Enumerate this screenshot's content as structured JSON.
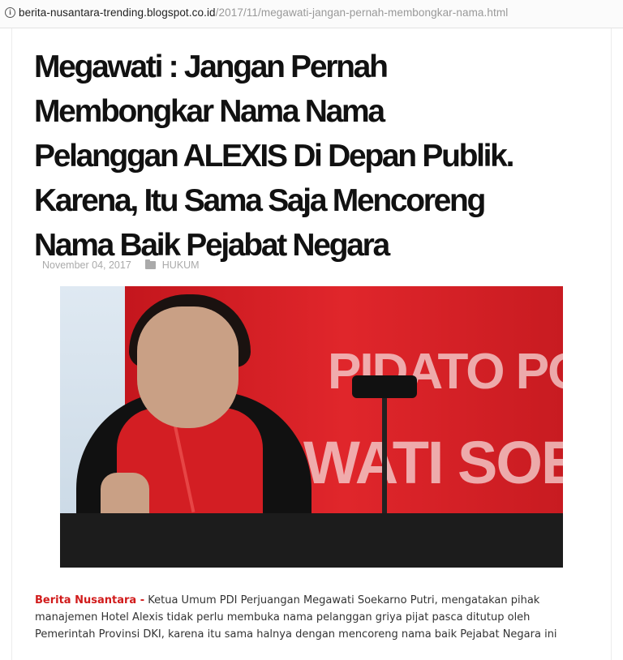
{
  "browser": {
    "url_host": "berita-nusantara-trending.blogspot.co.id",
    "url_path": "/2017/11/megawati-jangan-pernah-membongkar-nama.html",
    "info_icon": "info-icon"
  },
  "article": {
    "title_lines": [
      "Megawati : Jangan Pernah",
      "Membongkar Nama Nama",
      "Pelanggan ALEXIS Di Depan Publik.",
      "Karena, Itu Sama Saja Mencoreng",
      "Nama Baik Pejabat Negara"
    ],
    "date": "November 04, 2017",
    "category_icon": "folder-icon",
    "category": "HUKUM",
    "image_banner_text": [
      "PIDATO POLI",
      "WATI SOEKA"
    ],
    "body_lead": "Berita Nusantara -",
    "body_text": " Ketua Umum PDI Perjuangan Megawati Soekarno Putri, mengatakan pihak manajemen Hotel Alexis tidak perlu membuka nama pelanggan griya pijat pasca ditutup oleh Pemerintah Provinsi DKI, karena itu sama halnya dengan mencoreng nama baik Pejabat Negara ini"
  }
}
